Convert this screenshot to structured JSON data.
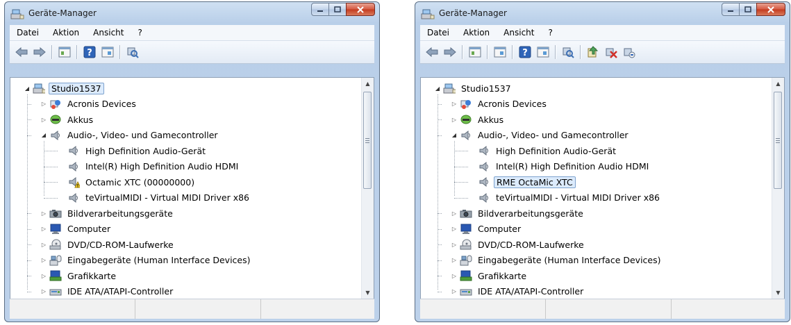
{
  "windows": [
    {
      "title": "Geräte-Manager",
      "menu": [
        "Datei",
        "Aktion",
        "Ansicht",
        "?"
      ],
      "toolbar": [
        "back-icon",
        "forward-icon",
        "sep",
        "properties-icon",
        "sep",
        "help-icon",
        "view-icon",
        "sep",
        "scan-icon"
      ],
      "tree": [
        {
          "label": "Studio1537",
          "level": 0,
          "expander": "open",
          "icon": "computer-root",
          "selected": true
        },
        {
          "label": "Acronis Devices",
          "level": 1,
          "expander": "closed",
          "icon": "acronis"
        },
        {
          "label": "Akkus",
          "level": 1,
          "expander": "closed",
          "icon": "battery"
        },
        {
          "label": "Audio-, Video- und Gamecontroller",
          "level": 1,
          "expander": "open",
          "icon": "speaker"
        },
        {
          "label": "High Definition Audio-Gerät",
          "level": 2,
          "expander": "none",
          "icon": "speaker"
        },
        {
          "label": "Intel(R) High Definition Audio HDMI",
          "level": 2,
          "expander": "none",
          "icon": "speaker"
        },
        {
          "label": "Octamic XTC (00000000)",
          "level": 2,
          "expander": "none",
          "icon": "speaker-warning"
        },
        {
          "label": "teVirtualMIDI - Virtual MIDI Driver x86",
          "level": 2,
          "expander": "none",
          "icon": "speaker"
        },
        {
          "label": "Bildverarbeitungsgeräte",
          "level": 1,
          "expander": "closed",
          "icon": "camera"
        },
        {
          "label": "Computer",
          "level": 1,
          "expander": "closed",
          "icon": "monitor"
        },
        {
          "label": "DVD/CD-ROM-Laufwerke",
          "level": 1,
          "expander": "closed",
          "icon": "dvd"
        },
        {
          "label": "Eingabegeräte (Human Interface Devices)",
          "level": 1,
          "expander": "closed",
          "icon": "hid"
        },
        {
          "label": "Grafikkarte",
          "level": 1,
          "expander": "closed",
          "icon": "display"
        },
        {
          "label": "IDE ATA/ATAPI-Controller",
          "level": 1,
          "expander": "closed",
          "icon": "ide"
        }
      ]
    },
    {
      "title": "Geräte-Manager",
      "menu": [
        "Datei",
        "Aktion",
        "Ansicht",
        "?"
      ],
      "toolbar": [
        "back-icon",
        "forward-icon",
        "sep",
        "properties-icon",
        "sep",
        "view-icon",
        "sep",
        "help-icon",
        "view-icon",
        "sep",
        "scan-icon",
        "sep",
        "update-driver-icon",
        "disable-icon",
        "uninstall-icon"
      ],
      "tree": [
        {
          "label": "Studio1537",
          "level": 0,
          "expander": "open",
          "icon": "computer-root"
        },
        {
          "label": "Acronis Devices",
          "level": 1,
          "expander": "closed",
          "icon": "acronis"
        },
        {
          "label": "Akkus",
          "level": 1,
          "expander": "closed",
          "icon": "battery"
        },
        {
          "label": "Audio-, Video- und Gamecontroller",
          "level": 1,
          "expander": "open",
          "icon": "speaker"
        },
        {
          "label": "High Definition Audio-Gerät",
          "level": 2,
          "expander": "none",
          "icon": "speaker"
        },
        {
          "label": "Intel(R) High Definition Audio HDMI",
          "level": 2,
          "expander": "none",
          "icon": "speaker"
        },
        {
          "label": "RME OctaMic XTC",
          "level": 2,
          "expander": "none",
          "icon": "speaker",
          "selected": true
        },
        {
          "label": "teVirtualMIDI - Virtual MIDI Driver x86",
          "level": 2,
          "expander": "none",
          "icon": "speaker"
        },
        {
          "label": "Bildverarbeitungsgeräte",
          "level": 1,
          "expander": "closed",
          "icon": "camera"
        },
        {
          "label": "Computer",
          "level": 1,
          "expander": "closed",
          "icon": "monitor"
        },
        {
          "label": "DVD/CD-ROM-Laufwerke",
          "level": 1,
          "expander": "closed",
          "icon": "dvd"
        },
        {
          "label": "Eingabegeräte (Human Interface Devices)",
          "level": 1,
          "expander": "closed",
          "icon": "hid"
        },
        {
          "label": "Grafikkarte",
          "level": 1,
          "expander": "closed",
          "icon": "display"
        },
        {
          "label": "IDE ATA/ATAPI-Controller",
          "level": 1,
          "expander": "closed",
          "icon": "ide"
        }
      ]
    }
  ]
}
